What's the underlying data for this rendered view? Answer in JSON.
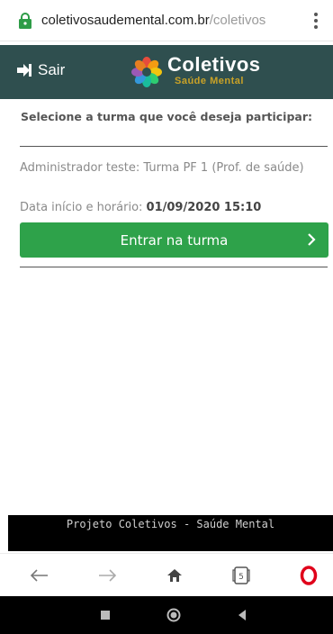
{
  "browser": {
    "url_domain": "coletivosaudemental.com.br",
    "url_path": "/coletivos",
    "tab_count": "5"
  },
  "header": {
    "logout_label": "Sair",
    "brand_title": "Coletivos",
    "brand_subtitle": "Saúde Mental"
  },
  "main": {
    "heading": "Selecione a turma que você deseja participar:",
    "turma_name": "Administrador teste: Turma PF 1 (Prof. de saúde)",
    "start_label": "Data início e horário:",
    "start_value": "01/09/2020 15:10",
    "enter_button": "Entrar na turma"
  },
  "footer": {
    "text": "Projeto Coletivos - Saúde Mental"
  },
  "colors": {
    "header_bg": "#2f4f4f",
    "button_green": "#2ea24a",
    "lock_green": "#2e9c47",
    "opera_red": "#e0001a",
    "subtitle_gold": "#c9a227"
  }
}
